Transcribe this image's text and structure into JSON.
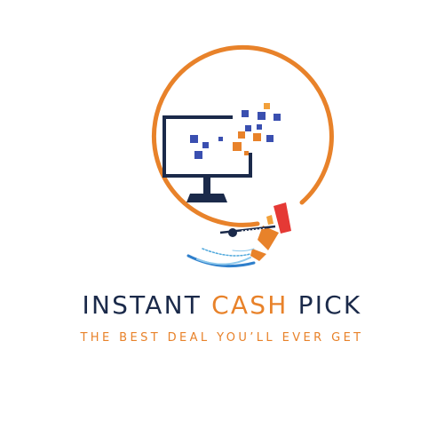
{
  "logo": {
    "name_part_1": "INSTANT",
    "name_part_2": "CASH",
    "name_part_3": "PICK",
    "tagline": "THE BEST DEAL YOU’LL EVER GET"
  },
  "colors": {
    "ring": "#e8822a",
    "navy": "#1b2a4a",
    "accent": "#e8822a",
    "red": "#e53935",
    "blue": "#3a4fb0",
    "light_blue": "#4fa8dc"
  },
  "icons": [
    "monitor-icon",
    "pixel-cluster-icon",
    "speed-gauge-icon",
    "speed-swoosh-icon"
  ]
}
